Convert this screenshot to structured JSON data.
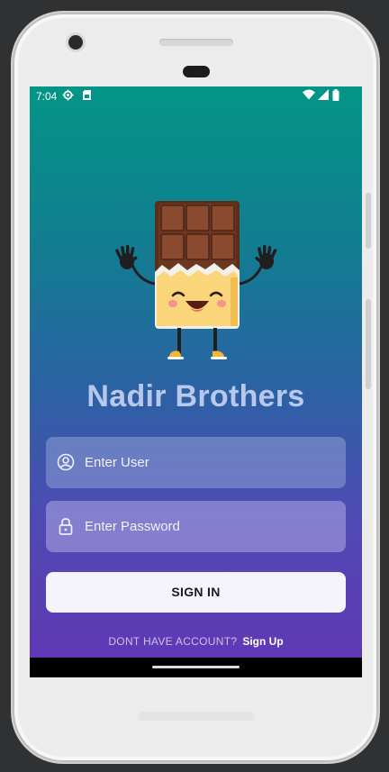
{
  "status_bar": {
    "time": "7:04"
  },
  "app": {
    "brand_name": "Nadir Brothers",
    "username_placeholder": "Enter User",
    "password_placeholder": "Enter Password",
    "signin_label": "SIGN IN",
    "footer_question": "DONT HAVE ACCOUNT?",
    "signup_link": "Sign Up"
  },
  "colors": {
    "gradient_top": "#039586",
    "gradient_bottom": "#6038b5",
    "brand_text": "#b8c8ea",
    "button_bg": "#f5f3fb"
  },
  "icons": [
    "settings-sync-icon",
    "sim-card-icon",
    "wifi-icon",
    "cell-signal-icon",
    "battery-icon",
    "user-icon",
    "lock-icon"
  ]
}
